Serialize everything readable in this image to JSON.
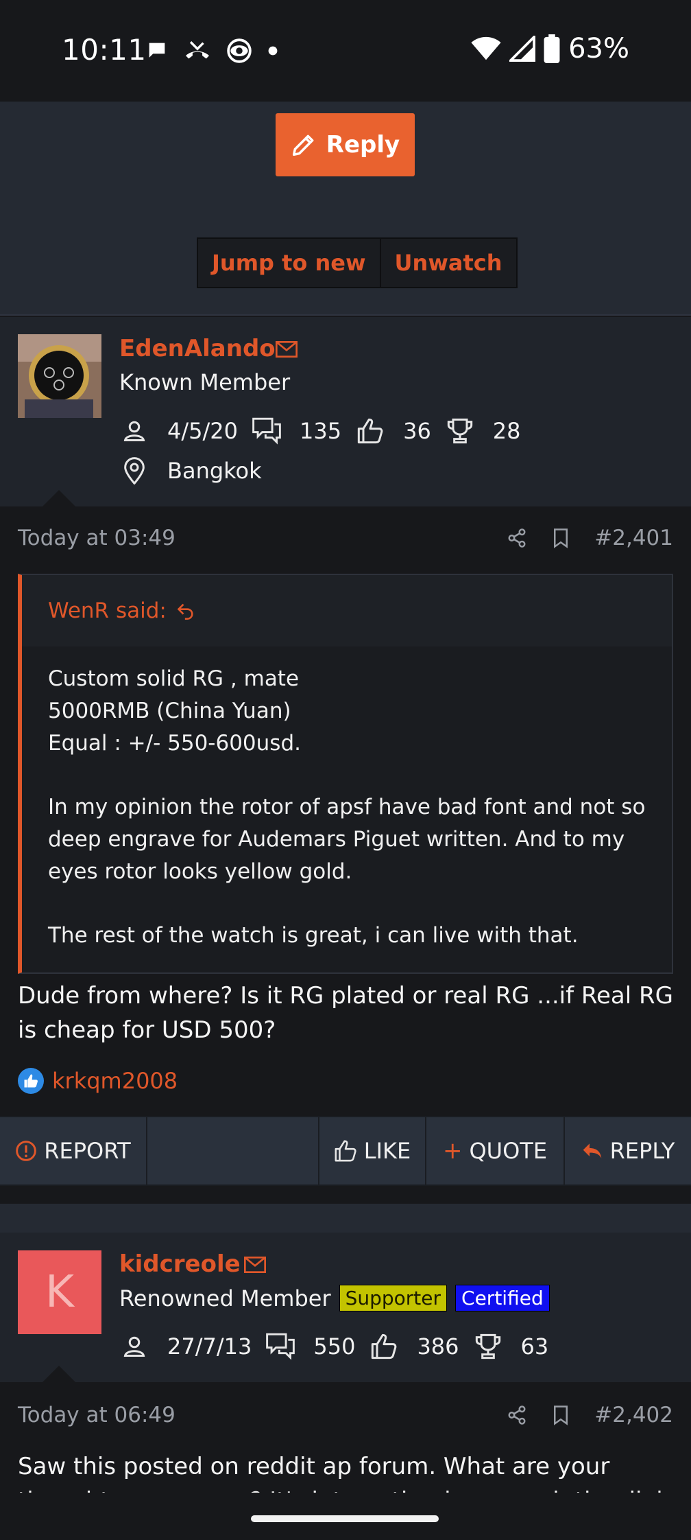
{
  "status_bar": {
    "time": "10:11",
    "battery": "63%",
    "icons": [
      "chat-bubble-icon",
      "missed-call-icon",
      "eye-icon",
      "dot-icon",
      "wifi-icon",
      "signal-icon",
      "battery-icon"
    ]
  },
  "toolbar": {
    "reply_label": "Reply",
    "jump_label": "Jump to new",
    "unwatch_label": "Unwatch"
  },
  "posts": [
    {
      "username": "EdenAlando",
      "user_title": "Known Member",
      "joined": "4/5/20",
      "messages": "135",
      "reactions": "36",
      "points": "28",
      "location": "Bangkok",
      "date": "Today at 03:49",
      "number": "#2,401",
      "quote": {
        "author": "WenR said:",
        "lines": [
          "Custom solid RG , mate",
          "5000RMB (China Yuan)",
          "Equal : +/- 550-600usd.",
          "In my opinion the rotor of apsf have bad font and not so deep engrave for Audemars Piguet written. And to my eyes rotor looks yellow gold.",
          "The rest of the watch is great, i can live with that."
        ]
      },
      "text": "Dude from where? Is it RG plated or real RG ...if Real RG is cheap for USD 500?",
      "liked_by": "krkqm2008",
      "actions": {
        "report": "REPORT",
        "like": "LIKE",
        "quote": "QUOTE",
        "reply": "REPLY"
      }
    },
    {
      "avatar_letter": "K",
      "username": "kidcreole",
      "user_title": "Renowned Member",
      "badge_supporter": "Supporter",
      "badge_certified": "Certified",
      "joined": "27/7/13",
      "messages": "550",
      "reactions": "386",
      "points": "63",
      "date": "Today at 06:49",
      "number": "#2,402",
      "text": "Saw this posted on reddit ap forum. What are your thoughts gen or rep? It's interesting how rough the dial"
    }
  ],
  "colors": {
    "accent": "#e0572a",
    "reply_button": "#e9622f",
    "background": "#17181b",
    "panel": "#20242b"
  }
}
